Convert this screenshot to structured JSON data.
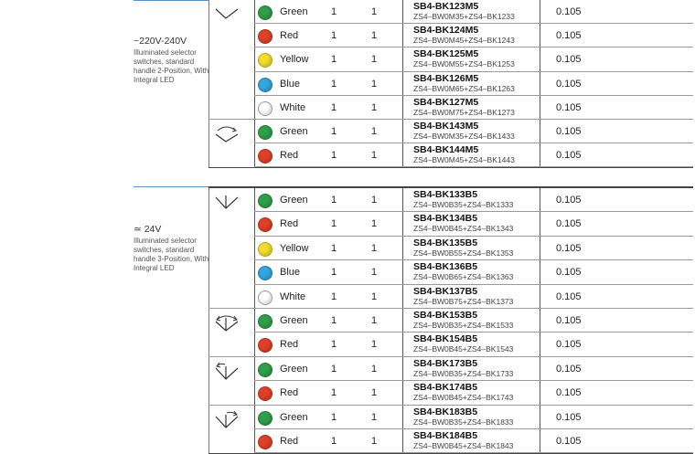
{
  "colors": {
    "Green": "#2fa04a",
    "Red": "#e04028",
    "Yellow": "#f2dd2c",
    "Blue": "#34a6e0",
    "White": "#ffffff"
  },
  "groups": [
    {
      "voltage": "~220V-240V",
      "description": "Illuminated selector switches, standard handle 2-Position, With Integral LED",
      "rows": [
        {
          "color": "Green",
          "qty1": "1",
          "qty2": "1",
          "ref": "SB4-BK123M5",
          "sub": "ZS4–BW0M35+ZS4–BK1233",
          "weight": "0.105",
          "icon": "selector-2pos-maintained-icon"
        },
        {
          "color": "Red",
          "qty1": "1",
          "qty2": "1",
          "ref": "SB4-BK124M5",
          "sub": "ZS4–BW0M45+ZS4–BK1243",
          "weight": "0.105"
        },
        {
          "color": "Yellow",
          "qty1": "1",
          "qty2": "1",
          "ref": "SB4-BK125M5",
          "sub": "ZS4–BW0M55+ZS4–BK1253",
          "weight": "0.105"
        },
        {
          "color": "Blue",
          "qty1": "1",
          "qty2": "1",
          "ref": "SB4-BK126M5",
          "sub": "ZS4–BW0M65+ZS4–BK1263",
          "weight": "0.105"
        },
        {
          "color": "White",
          "qty1": "1",
          "qty2": "1",
          "ref": "SB4-BK127M5",
          "sub": "ZS4–BW0M75+ZS4–BK1273",
          "weight": "0.105"
        },
        {
          "color": "Green",
          "qty1": "1",
          "qty2": "1",
          "ref": "SB4-BK143M5",
          "sub": "ZS4–BW0M35+ZS4–BK1433",
          "weight": "0.105",
          "icon": "selector-2pos-spring-return-icon"
        },
        {
          "color": "Red",
          "qty1": "1",
          "qty2": "1",
          "ref": "SB4-BK144M5",
          "sub": "ZS4–BW0M45+ZS4–BK1443",
          "weight": "0.105"
        }
      ]
    },
    {
      "voltage": "≃ 24V",
      "description": "Illuminated selector switches, standard handle 3-Position, With Integral LED",
      "rows": [
        {
          "color": "Green",
          "qty1": "1",
          "qty2": "1",
          "ref": "SB4-BK133B5",
          "sub": "ZS4–BW0B35+ZS4–BK1333",
          "weight": "0.105",
          "icon": "selector-3pos-maintained-icon"
        },
        {
          "color": "Red",
          "qty1": "1",
          "qty2": "1",
          "ref": "SB4-BK134B5",
          "sub": "ZS4–BW0B45+ZS4–BK1343",
          "weight": "0.105"
        },
        {
          "color": "Yellow",
          "qty1": "1",
          "qty2": "1",
          "ref": "SB4-BK135B5",
          "sub": "ZS4–BW0B55+ZS4–BK1353",
          "weight": "0.105"
        },
        {
          "color": "Blue",
          "qty1": "1",
          "qty2": "1",
          "ref": "SB4-BK136B5",
          "sub": "ZS4–BW0B65+ZS4–BK1363",
          "weight": "0.105"
        },
        {
          "color": "White",
          "qty1": "1",
          "qty2": "1",
          "ref": "SB4-BK137B5",
          "sub": "ZS4–BW0B75+ZS4–BK1373",
          "weight": "0.105"
        },
        {
          "color": "Green",
          "qty1": "1",
          "qty2": "1",
          "ref": "SB4-BK153B5",
          "sub": "ZS4–BW0B35+ZS4–BK1533",
          "weight": "0.105",
          "icon": "selector-3pos-spring-both-icon"
        },
        {
          "color": "Red",
          "qty1": "1",
          "qty2": "1",
          "ref": "SB4-BK154B5",
          "sub": "ZS4–BW0B45+ZS4–BK1543",
          "weight": "0.105"
        },
        {
          "color": "Green",
          "qty1": "1",
          "qty2": "1",
          "ref": "SB4-BK173B5",
          "sub": "ZS4–BW0B35+ZS4–BK1733",
          "weight": "0.105",
          "icon": "selector-3pos-spring-left-icon"
        },
        {
          "color": "Red",
          "qty1": "1",
          "qty2": "1",
          "ref": "SB4-BK174B5",
          "sub": "ZS4–BW0B45+ZS4–BK1743",
          "weight": "0.105"
        },
        {
          "color": "Green",
          "qty1": "1",
          "qty2": "1",
          "ref": "SB4-BK183B5",
          "sub": "ZS4–BW0B35+ZS4–BK1833",
          "weight": "0.105",
          "icon": "selector-3pos-spring-right-icon"
        },
        {
          "color": "Red",
          "qty1": "1",
          "qty2": "1",
          "ref": "SB4-BK184B5",
          "sub": "ZS4–BW0B45+ZS4–BK1843",
          "weight": "0.105"
        }
      ]
    }
  ]
}
